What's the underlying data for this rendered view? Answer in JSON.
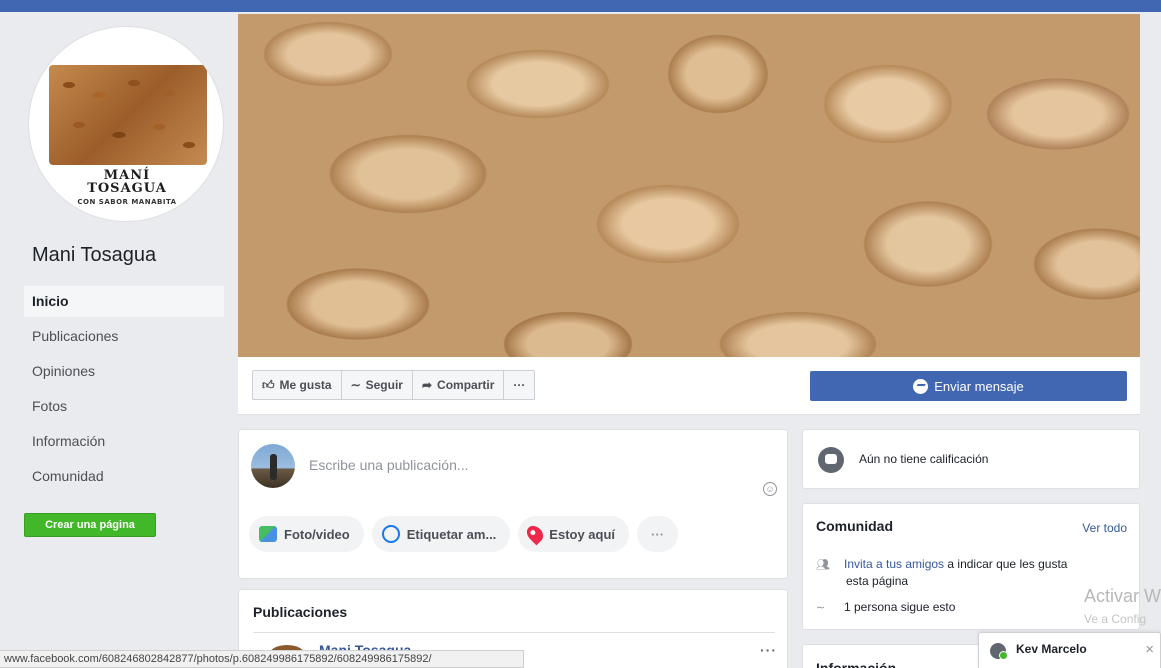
{
  "page": {
    "name": "Mani Tosagua",
    "profile_brand_line1": "MANÍ",
    "profile_brand_line2": "TOSAGUA",
    "profile_brand_line3": "CON SABOR MANABITA"
  },
  "nav": {
    "items": [
      {
        "label": "Inicio",
        "active": true
      },
      {
        "label": "Publicaciones"
      },
      {
        "label": "Opiniones"
      },
      {
        "label": "Fotos"
      },
      {
        "label": "Información"
      },
      {
        "label": "Comunidad"
      }
    ],
    "create_page": "Crear una página"
  },
  "actions": {
    "like": "Me gusta",
    "follow": "Seguir",
    "share": "Compartir",
    "more": "···",
    "send_message": "Enviar mensaje"
  },
  "composer": {
    "placeholder": "Escribe una publicación...",
    "photo_video": "Foto/video",
    "tag_friends": "Etiquetar am...",
    "check_in": "Estoy aquí",
    "more": "···"
  },
  "posts": {
    "title": "Publicaciones",
    "first_author": "Mani Tosagua",
    "more": "···"
  },
  "rating": {
    "text": "Aún no tiene calificación"
  },
  "community": {
    "title": "Comunidad",
    "see_all": "Ver todo",
    "invite_link": "Invita a tus amigos",
    "invite_rest_1": " a indicar que les gusta",
    "invite_rest_2": "esta página",
    "followers": "1 persona sigue esto"
  },
  "info": {
    "title": "Información"
  },
  "watermark": {
    "line1": "Activar W",
    "line2": "Ve a Config"
  },
  "chat": {
    "name": "Kev Marcelo",
    "close": "×"
  },
  "statusbar": {
    "url": "www.facebook.com/608246802842877/photos/p.608249986175892/608249986175892/"
  },
  "colors": {
    "brand_blue": "#4267b2",
    "link_blue": "#365899",
    "create_green": "#42b72a"
  }
}
